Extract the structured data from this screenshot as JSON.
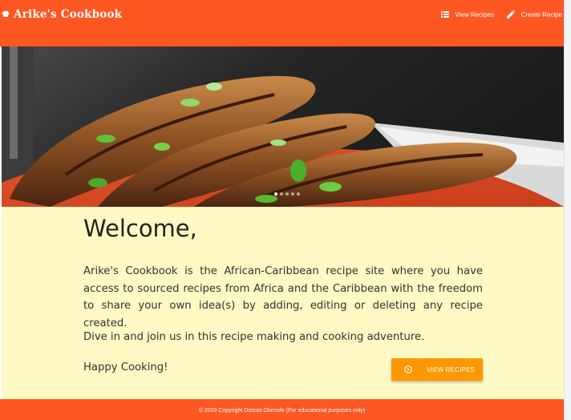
{
  "navbar": {
    "brand": "Arike's Cookbook",
    "brand_icon": "chef-hat-icon",
    "links": [
      {
        "label": "View Recipes",
        "icon": "list-icon"
      },
      {
        "label": "Create Recipe",
        "icon": "pencil-icon"
      }
    ]
  },
  "hero": {
    "carousel_indicators": 5,
    "active_index": 0
  },
  "main": {
    "title": "Welcome,",
    "paragraph_1": "Arike's Cookbook is the African-Caribbean recipe site where you have access to sourced recipes from Africa and the Caribbean with the freedom to share your own idea(s) by adding, editing or deleting any recipe created.",
    "paragraph_2": "Dive in and join us in this recipe making and cooking adventure.",
    "paragraph_3": "Happy Cooking!",
    "button_label": "VIEW RECIPES",
    "button_icon": "play-circle-icon"
  },
  "footer": {
    "text": "© 2020 Copyright Dorcas Olomofe (For educational purposes only)"
  },
  "colors": {
    "primary": "#ff5722",
    "accent": "#ff9800",
    "content_bg": "#fff9c4"
  }
}
